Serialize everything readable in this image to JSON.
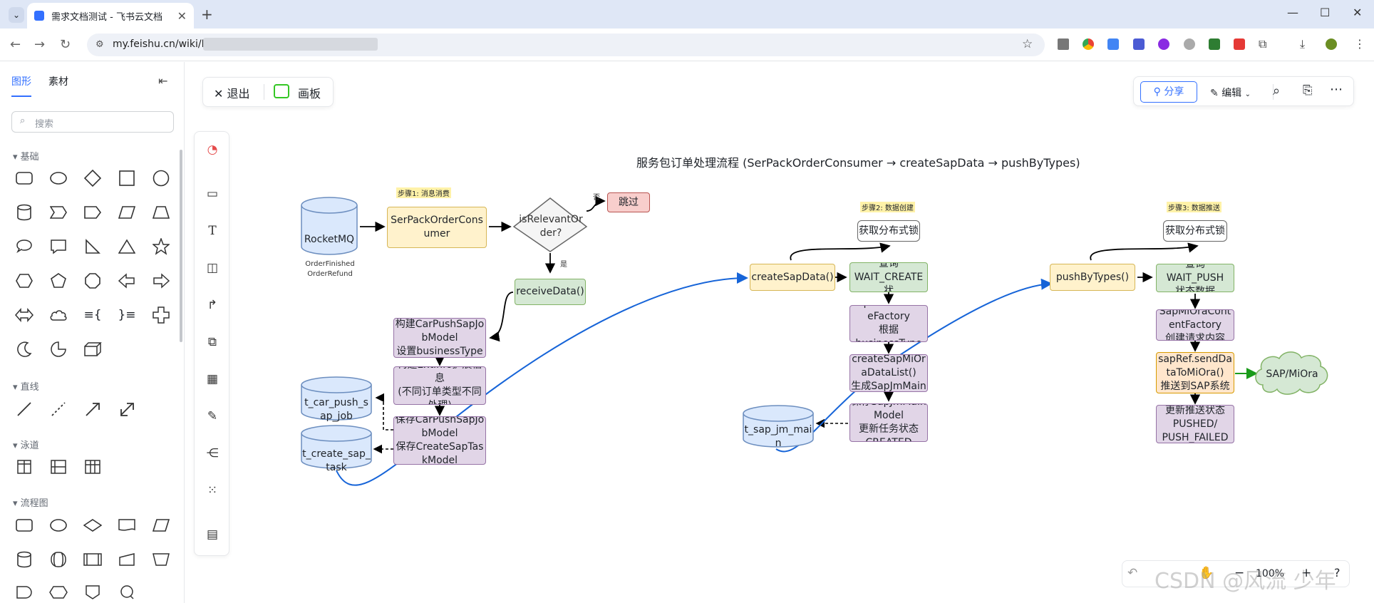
{
  "browser": {
    "tab_title": "需求文档测试 - 飞书云文档",
    "url": "my.feishu.cn/wiki/M"
  },
  "sidebar": {
    "tabs": [
      "图形",
      "素材"
    ],
    "search_placeholder": "搜索",
    "sections": [
      "基础",
      "直线",
      "泳道",
      "流程图"
    ]
  },
  "topbar": {
    "exit_label": "退出",
    "board_label": "画板",
    "share_label": "分享",
    "edit_label": "编辑"
  },
  "diagram": {
    "title": "服务包订单处理流程 (SerPackOrderConsumer → createSapData → pushByTypes)",
    "step1_label": "步骤1: 消息消费",
    "step2_label": "步骤2: 数据创建",
    "step3_label": "步骤3: 数据推送",
    "rocketmq": "RocketMQ",
    "rocketmq_note": "OrderFinished\nOrderRefund",
    "consumer": "SerPackOrderConsumer",
    "decision": "isRelevantOrder?",
    "no_label": "否",
    "yes_label": "是",
    "skip": "跳过",
    "receive": "receiveData()",
    "build_model": "构建CarPushSapJobModel\n设置businessType",
    "build_ext": "构建ExtInfo扩展信息\n(不同订单类型不同处理)",
    "save_model": "保存CarPushSapJobModel\n保存CreateSapTaskModel",
    "db_push_job": "t_car_push_sap_job",
    "db_create_task": "t_create_sap_task",
    "create_sap": "createSapData()",
    "lock1": "获取分布式锁",
    "query_create": "查询\nWAIT_CREATE状",
    "factory": "SapMiOraCreateFactory\n根据\nbusinessType",
    "create_list": "createSapMiOraDataList()\n生成SapJmMain",
    "save_main": "保存SapJmMain\nModel\n更新任务状态\nCREATED",
    "db_main": "t_sap_jm_main",
    "push_types": "pushByTypes()",
    "lock2": "获取分布式锁",
    "query_push": "查询WAIT_PUSH\n状态数据",
    "content_factory": "SapMiOraContentFactory\n创建请求内容",
    "send": "sapRef.sendDataToMiOra()\n推送到SAP系统",
    "update_status": "更新推送状态\nPUSHED/\nPUSH_FAILED",
    "sap_cloud": "SAP/MiOra"
  },
  "bottom": {
    "zoom": "100%",
    "watermark": "CSDN @风流 少年"
  }
}
